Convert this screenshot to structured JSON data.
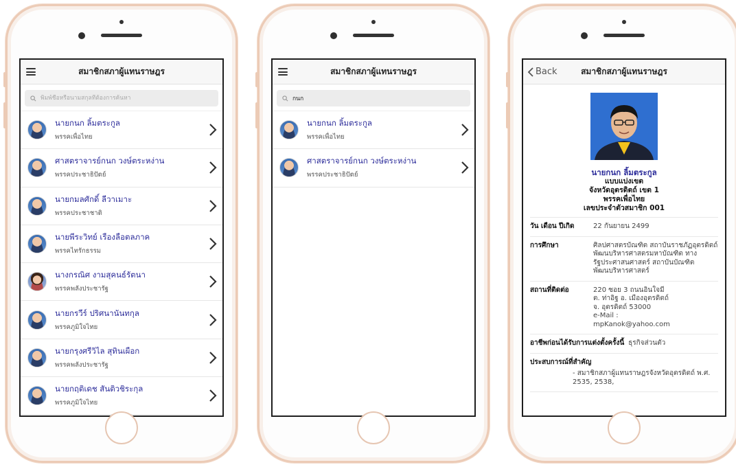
{
  "list_screen": {
    "title": "สมาชิกสภาผู้แทนราษฎร",
    "search_placeholder": "พิมพ์ชื่อหรือนามสกุลที่ต้องการค้นหา",
    "search_value": "",
    "items": [
      {
        "name": "นายกนก ลิ้มตระกูล",
        "party": "พรรคเพื่อไทย"
      },
      {
        "name": "ศาสตราจารย์กนก วงษ์ตระหง่าน",
        "party": "พรรคประชาธิปัตย์"
      },
      {
        "name": "นายกมลศักดิ์ ลีวาเมาะ",
        "party": "พรรคประชาชาติ"
      },
      {
        "name": "นายพีระวิทย์ เรืองลือตลภาค",
        "party": "พรรคไทรักธรรม"
      },
      {
        "name": "นางกรณิศ งามสุคนธ์รัตนา",
        "party": "พรรคพลังประชารัฐ"
      },
      {
        "name": "นายกรวีร์ ปริศนานันทกุล",
        "party": "พรรคภูมิใจไทย"
      },
      {
        "name": "นายกรุงศรีวิไล สุทินเผือก",
        "party": "พรรคพลังประชารัฐ"
      },
      {
        "name": "นายกฤติเดช สันติวชิระกุล",
        "party": "พรรคภูมิใจไทย"
      }
    ]
  },
  "search_screen": {
    "title": "สมาชิกสภาผู้แทนราษฎร",
    "search_value": "กนก",
    "items": [
      {
        "name": "นายกนก ลิ้มตระกูล",
        "party": "พรรคเพื่อไทย"
      },
      {
        "name": "ศาสตราจารย์กนก วงษ์ตระหง่าน",
        "party": "พรรคประชาธิปัตย์"
      }
    ]
  },
  "detail_screen": {
    "back_label": "Back",
    "title": "สมาชิกสภาผู้แทนราษฎร",
    "name": "นายกนก ลิ้มตระกูล",
    "type": "แบบแบ่งเขต",
    "district": "จังหวัดอุตรดิตถ์ เขต 1",
    "party": "พรรคเพื่อไทย",
    "member_no": "เลขประจำตัวสมาชิก 001",
    "birth_label": "วัน เดือน ปีเกิด",
    "birth_value": "22 กันยายน 2499",
    "education_label": "การศึกษา",
    "education_value": "ศิลปศาสตรบัณฑิต สถาบันราชภัฏอุตรดิตถ์ พัฒนบริหารศาสตรมหาบัณฑิต ทางรัฐประศาสนศาสตร์ สถาบันบัณฑิตพัฒนบริหารศาสตร์",
    "address_label": "สถานที่ติดต่อ",
    "address_lines": [
      "220 ซอย 3 ถนนอินใจมี",
      "ต. ท่าอิฐ อ. เมืองอุตรดิตถ์",
      "จ. อุตรดิตถ์ 53000",
      "e-Mail :",
      "mpKanok@yahoo.com"
    ],
    "occupation_label": "อาชีพก่อนได้รับการแต่งตั้งครั้งนี้",
    "occupation_value": "ธุรกิจส่วนตัว",
    "experience_label": "ประสบการณ์ที่สำคัญ",
    "experience_value": "- สมาชิกสภาผู้แทนราษฎรจังหวัดอุตรดิตถ์ พ.ศ. 2535, 2538,"
  }
}
